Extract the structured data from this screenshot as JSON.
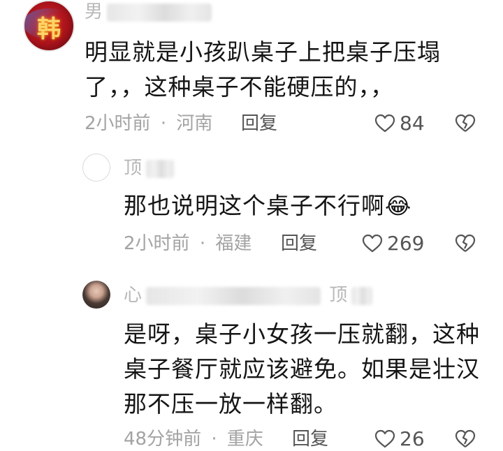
{
  "comments": [
    {
      "author": "男",
      "text": "明显就是小孩趴桌子上把桌子压塌了，，这种桌子不能硬压的，，",
      "text_lines": [
        "明显就是小孩趴桌子上把桌子压塌",
        "了，，这种桌子不能硬压的，，"
      ],
      "time": "2小时前",
      "location": "河南",
      "reply_label": "回复",
      "likes": "84",
      "avatar_glyph": "韩"
    },
    {
      "author": "顶",
      "text": "那也说明这个桌子不行啊",
      "text_lines": [
        "那也说明这个桌子不行啊"
      ],
      "time": "2小时前",
      "location": "福建",
      "reply_label": "回复",
      "likes": "269",
      "emoji": "😂"
    },
    {
      "author": "心",
      "author_tail": "顶",
      "text": "是呀，桌子小女孩一压就翻，这种桌子餐厅就应该避免。如果是壮汉那不压一放一样翻。",
      "text_lines": [
        "是呀，桌子小女孩一压就翻，这种",
        "桌子餐厅就应该避免。如果是壮汉",
        "那不压一放一样翻。"
      ],
      "time": "48分钟前",
      "location": "重庆",
      "reply_label": "回复",
      "likes": "26"
    }
  ],
  "meta_separator": "·",
  "colors": {
    "accent_avatar": "#c0181c",
    "meta": "#a3a3a3"
  }
}
